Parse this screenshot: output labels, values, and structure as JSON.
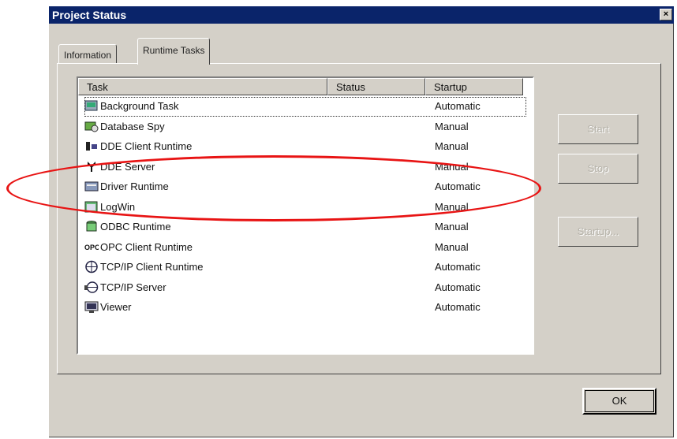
{
  "window": {
    "title": "Project Status",
    "close_label": "×"
  },
  "tabs": [
    {
      "label": "Information",
      "active": false
    },
    {
      "label": "Runtime Tasks",
      "active": true
    }
  ],
  "list": {
    "columns": [
      "Task",
      "Status",
      "Startup"
    ],
    "rows": [
      {
        "name": "Background Task",
        "status": "",
        "startup": "Automatic",
        "icon": "background-task-icon",
        "focused": true
      },
      {
        "name": "Database Spy",
        "status": "",
        "startup": "Manual",
        "icon": "database-spy-icon"
      },
      {
        "name": "DDE Client Runtime",
        "status": "",
        "startup": "Manual",
        "icon": "dde-client-icon"
      },
      {
        "name": "DDE Server",
        "status": "",
        "startup": "Manual",
        "icon": "dde-server-icon"
      },
      {
        "name": "Driver Runtime",
        "status": "",
        "startup": "Automatic",
        "icon": "driver-runtime-icon"
      },
      {
        "name": "LogWin",
        "status": "",
        "startup": "Manual",
        "icon": "logwin-icon"
      },
      {
        "name": "ODBC Runtime",
        "status": "",
        "startup": "Manual",
        "icon": "odbc-runtime-icon"
      },
      {
        "name": "OPC Client Runtime",
        "status": "",
        "startup": "Manual",
        "icon": "opc-client-icon"
      },
      {
        "name": "TCP/IP Client Runtime",
        "status": "",
        "startup": "Automatic",
        "icon": "tcpip-client-icon"
      },
      {
        "name": "TCP/IP Server",
        "status": "",
        "startup": "Automatic",
        "icon": "tcpip-server-icon"
      },
      {
        "name": "Viewer",
        "status": "",
        "startup": "Automatic",
        "icon": "viewer-icon"
      }
    ]
  },
  "buttons": {
    "start": "Start",
    "stop": "Stop",
    "startup": "Startup...",
    "ok": "OK"
  },
  "annotation": {
    "color": "#e81414",
    "target_rows": [
      "DDE Server",
      "Driver Runtime"
    ]
  },
  "colors": {
    "title_bar": "#0a246a",
    "face": "#d4d0c8"
  }
}
